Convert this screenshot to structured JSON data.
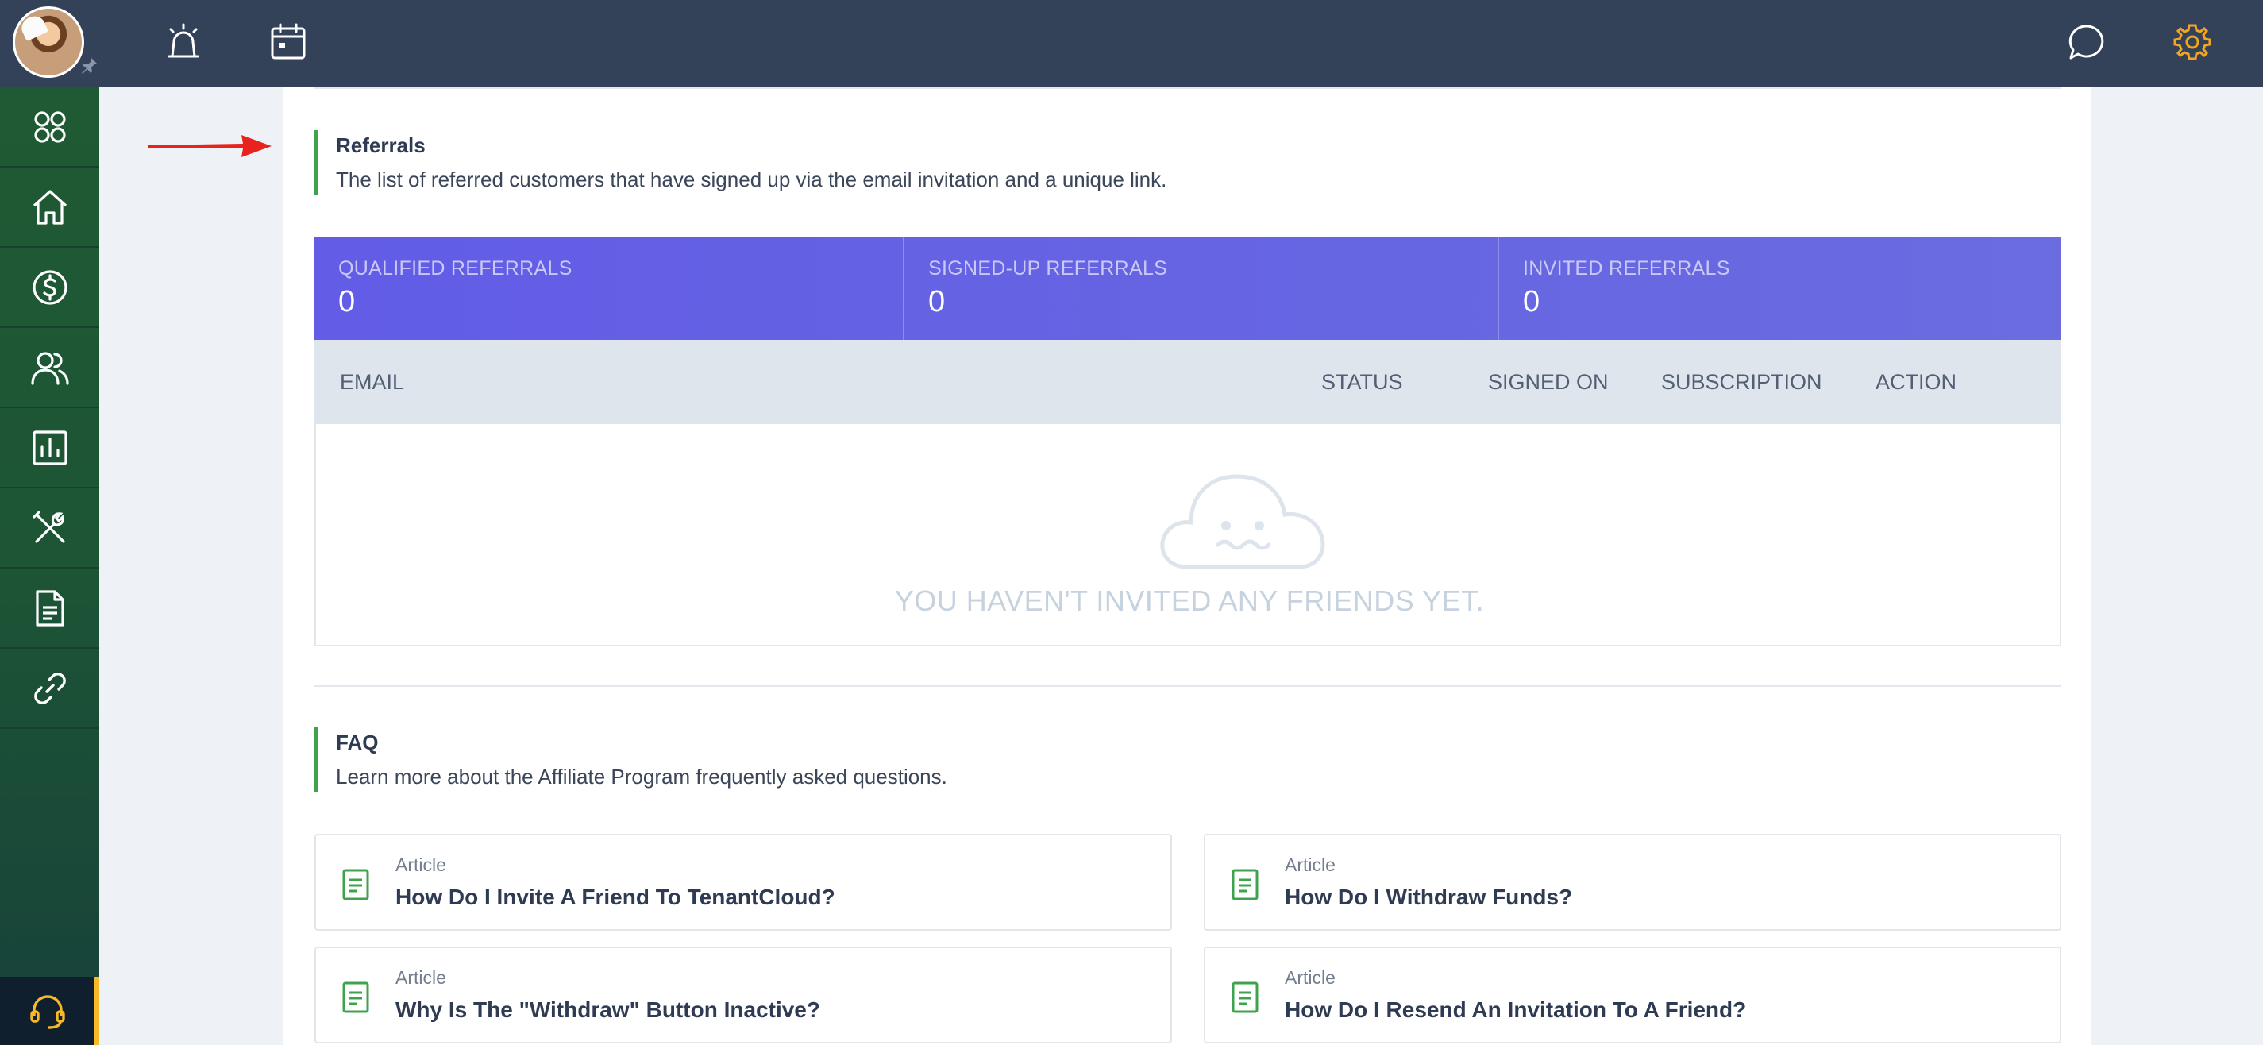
{
  "topbar": {
    "icons": [
      "avatar",
      "pin-icon",
      "alarm-icon",
      "calendar-icon",
      "chat-icon",
      "gear-icon"
    ],
    "accent_gear": "#f3a521"
  },
  "sidebar": {
    "items": [
      "apps-icon",
      "home-icon",
      "dollar-icon",
      "users-icon",
      "reports-icon",
      "tools-icon",
      "document-icon",
      "link-icon"
    ],
    "help": "headset-icon"
  },
  "referrals": {
    "title": "Referrals",
    "description": "The list of referred customers that have signed up via the email invitation and a unique link.",
    "stats": [
      {
        "label": "QUALIFIED REFERRALS",
        "value": "0"
      },
      {
        "label": "SIGNED-UP REFERRALS",
        "value": "0"
      },
      {
        "label": "INVITED REFERRALS",
        "value": "0"
      }
    ],
    "columns": {
      "email": "EMAIL",
      "status": "STATUS",
      "signed_on": "SIGNED ON",
      "subscription": "SUBSCRIPTION",
      "action": "ACTION"
    },
    "empty_message": "YOU HAVEN'T INVITED ANY FRIENDS YET."
  },
  "faq": {
    "title": "FAQ",
    "description": "Learn more about the Affiliate Program frequently asked questions.",
    "articles": [
      {
        "kind": "Article",
        "title": "How Do I Invite A Friend To TenantCloud?"
      },
      {
        "kind": "Article",
        "title": "How Do I Withdraw Funds?"
      },
      {
        "kind": "Article",
        "title": "Why Is The \"Withdraw\" Button Inactive?"
      },
      {
        "kind": "Article",
        "title": "How Do I Resend An Invitation To A Friend?"
      }
    ]
  },
  "colors": {
    "topbar": "#344259",
    "sidebar": "#1f5a34",
    "stats_band": "#625ce6",
    "section_accent": "#3fa34d"
  }
}
